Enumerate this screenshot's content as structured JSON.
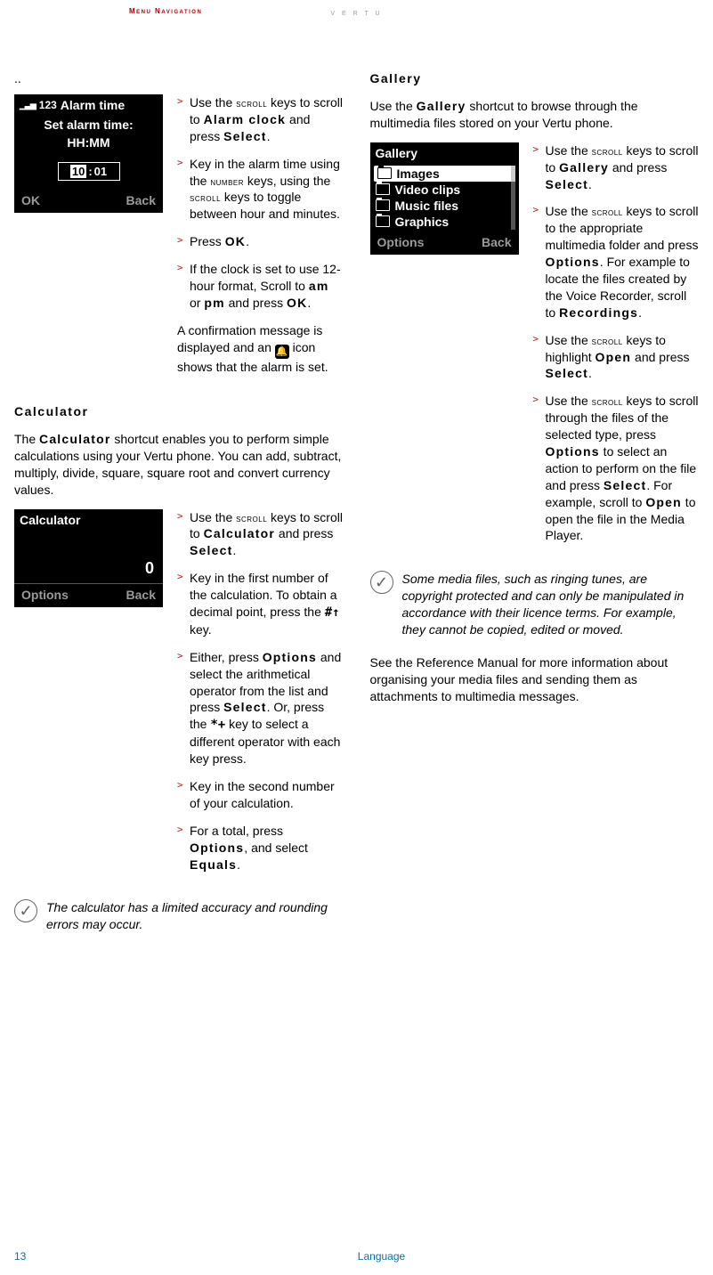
{
  "header": {
    "section": "Menu Navigation",
    "brand": "V E R T U"
  },
  "dots": "..",
  "alarm": {
    "phone": {
      "titlebar_icons": "▁▃▅",
      "titlebar_num": "123",
      "title": "Alarm time",
      "subtitle": "Set alarm time:",
      "topline": "HH:MM",
      "hh": "10",
      "sep": ":",
      "mm": "01",
      "left": "OK",
      "right": "Back"
    },
    "steps": {
      "a_pre": "Use the ",
      "a_sc": "scroll",
      "a_mid": " keys to scroll to ",
      "a_key1": "Alarm clock",
      "a_mid2": " and press ",
      "a_key2": "Select",
      "a_end": ".",
      "b_pre": "Key in the alarm time using the ",
      "b_num": "number",
      "b_mid": " keys, using the ",
      "b_sc": "scroll",
      "b_end": " keys to toggle between hour and minutes.",
      "c_pre": "Press ",
      "c_key": "OK",
      "c_end": ".",
      "d_pre": "If the clock is set to use 12-hour format, Scroll to ",
      "d_am": "am",
      "d_or": " or ",
      "d_pm": "pm",
      "d_mid": " and press ",
      "d_key": "OK",
      "d_end": ".",
      "e_pre": "A confirmation message is displayed and an ",
      "e_post": " icon shows that the alarm is set."
    }
  },
  "calc": {
    "heading": "Calculator",
    "intro_pre": "The ",
    "intro_key": "Calculator",
    "intro_post": " shortcut  enables you to perform simple calculations using your Vertu phone. You can  add, subtract, multiply, divide, square, square root and convert currency values.",
    "phone": {
      "title": "Calculator",
      "value": "0",
      "left": "Options",
      "right": "Back"
    },
    "steps": {
      "a_pre": "Use the ",
      "a_sc": "scroll",
      "a_mid": " keys to scroll to ",
      "a_key": "Calculator",
      "a_mid2": " and press ",
      "a_key2": "Select",
      "a_end": ".",
      "b_pre": "Key in the first number of the calculation. To obtain a decimal point, press the ",
      "b_keycap": "#↑",
      "b_end": " key.",
      "c_pre": "Either, press ",
      "c_key1": "Options",
      "c_mid1": " and select the arithmetical operator from the list and press ",
      "c_key2": "Select",
      "c_mid2": ". Or, press the ",
      "c_keycap": "*+",
      "c_end": " key to select a different operator with each key press.",
      "d": "Key in the second number of your calculation.",
      "e_pre": "For a total, press ",
      "e_key1": "Options",
      "e_mid": ", and select ",
      "e_key2": "Equals",
      "e_end": "."
    },
    "note": "The calculator has a limited accuracy and rounding errors may occur."
  },
  "gallery": {
    "heading": "Gallery",
    "intro_pre": "Use the ",
    "intro_key": "Gallery",
    "intro_post": " shortcut to browse through the multimedia files stored on your Vertu phone.",
    "phone": {
      "title": "Gallery",
      "items": [
        "Images",
        "Video clips",
        "Music files",
        "Graphics"
      ],
      "left": "Options",
      "right": "Back"
    },
    "steps": {
      "a_pre": "Use the ",
      "a_sc": "scroll",
      "a_mid": " keys to scroll to ",
      "a_key": "Gallery",
      "a_mid2": " and press ",
      "a_key2": "Select",
      "a_end": ".",
      "b_pre": "Use the ",
      "b_sc": "scroll",
      "b_mid": " keys to scroll to the appropriate multimedia folder and press ",
      "b_key": "Options",
      "b_mid2": ". For example to locate the files created by the Voice Recorder, scroll to ",
      "b_key2": "Recordings",
      "b_end": ".",
      "c_pre": "Use the ",
      "c_sc": "scroll",
      "c_mid": " keys to highlight ",
      "c_key": "Open",
      "c_mid2": " and press ",
      "c_key2": "Select",
      "c_end": ".",
      "d_pre": "Use the ",
      "d_sc": "scroll",
      "d_mid": " keys to scroll through the files of the selected type, press ",
      "d_key1": "Options",
      "d_mid2": " to select an action to perform on the file and press ",
      "d_key2": "Select",
      "d_mid3": ". For example, scroll to ",
      "d_key3": "Open",
      "d_end": " to open the file in the Media Player."
    },
    "note": "Some media files, such as ringing tunes, are copyright protected and can only be manipulated in accordance with their licence terms. For example, they cannot be copied, edited or moved.",
    "outro": "See the Reference Manual for more information about organising your media files and sending them as attachments to multimedia messages."
  },
  "footer": {
    "page": "13",
    "lang": "Language"
  }
}
